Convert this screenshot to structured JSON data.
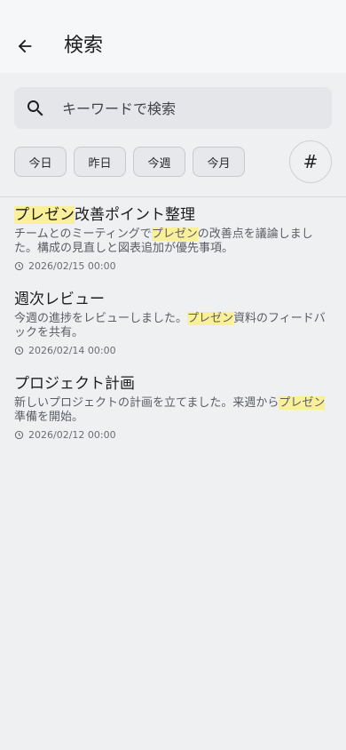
{
  "header": {
    "title": "検索",
    "back_icon": "arrow-back-icon"
  },
  "search": {
    "placeholder": "キーワードで検索",
    "value": ""
  },
  "filters": [
    {
      "label": "今日"
    },
    {
      "label": "昨日"
    },
    {
      "label": "今週"
    },
    {
      "label": "今月"
    }
  ],
  "tag_button": {
    "label": "#"
  },
  "results": [
    {
      "title_hl": "プレゼン",
      "title_rest": "改善ポイント整理",
      "snippet_a": "チームとのミーティングで",
      "snippet_hl": "プレゼン",
      "snippet_b": "の改善点を議論しました。構成の見直しと図表追加が優先事項。",
      "timestamp": "2026/02/15 00:00"
    },
    {
      "title": "週次レビュー",
      "snippet_a": "今週の進捗をレビューしました。",
      "snippet_hl": "プレゼン",
      "snippet_b": "資料のフィードバックを共有。",
      "timestamp": "2026/02/14 00:00"
    },
    {
      "title": "プロジェクト計画",
      "snippet_a": "新しいプロジェクトの計画を立てました。来週から",
      "snippet_hl": "プレゼン",
      "snippet_b": "準備を開始。",
      "timestamp": "2026/02/12 00:00"
    }
  ],
  "colors": {
    "highlight": "#fbf09a",
    "background": "#eff0f2"
  }
}
